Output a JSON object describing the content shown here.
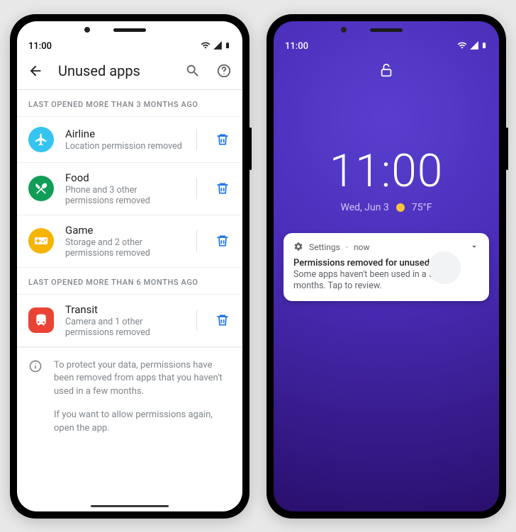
{
  "left_phone": {
    "statusbar": {
      "time": "11:00"
    },
    "header": {
      "title": "Unused apps"
    },
    "sections": [
      {
        "label": "LAST OPENED MORE THAN 3 MONTHS AGO"
      },
      {
        "label": "LAST OPENED MORE THAN 6 MONTHS AGO"
      }
    ],
    "apps_3mo": [
      {
        "name": "Airline",
        "sub": "Location permission removed",
        "icon": "plane",
        "bg": "#35c4f0"
      },
      {
        "name": "Food",
        "sub": "Phone and 3 other permissions removed",
        "icon": "fork",
        "bg": "#0f9d58"
      },
      {
        "name": "Game",
        "sub": "Storage and 2 other permissions removed",
        "icon": "gamepad",
        "bg": "#f4b400"
      }
    ],
    "apps_6mo": [
      {
        "name": "Transit",
        "sub": "Camera and 1 other permissions removed",
        "icon": "transit",
        "bg": "#ea4335"
      }
    ],
    "info": {
      "p1": "To protect your data, permissions have been removed from  apps that you haven't used in a few months.",
      "p2": "If you want to allow permissions again, open the app."
    }
  },
  "right_phone": {
    "statusbar": {
      "time": "11:00"
    },
    "clock": "11:00",
    "date": "Wed, Jun 3",
    "temp": "75°F",
    "notification": {
      "app": "Settings",
      "when": "now",
      "separator": " · ",
      "title": "Permissions removed for unused apps",
      "body": "Some apps haven't been used in a few months. Tap to review."
    }
  }
}
